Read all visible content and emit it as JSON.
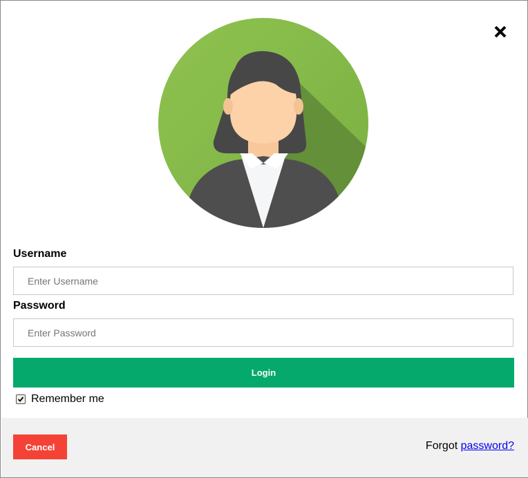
{
  "form": {
    "username_label": "Username",
    "username_placeholder": "Enter Username",
    "username_value": "",
    "password_label": "Password",
    "password_placeholder": "Enter Password",
    "password_value": "",
    "login_label": "Login",
    "remember_label": "Remember me",
    "remember_checked": true
  },
  "footer": {
    "cancel_label": "Cancel",
    "forgot_prefix": "Forgot",
    "forgot_link": "password?"
  },
  "icons": {
    "close": "close-icon",
    "avatar": "avatar-woman-icon",
    "checkbox": "checkmark-icon"
  },
  "colors": {
    "login_button": "#04a96b",
    "cancel_button": "#f44336",
    "avatar_background": "#8bc34a",
    "link": "#0000ee"
  }
}
